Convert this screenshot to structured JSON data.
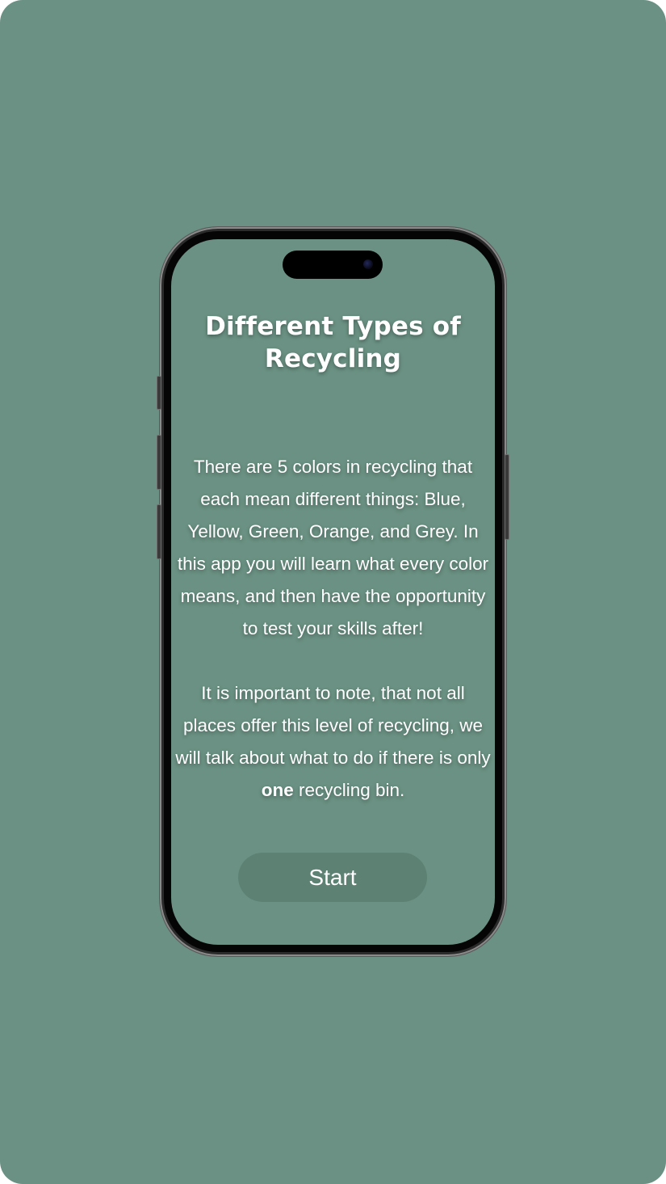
{
  "screen": {
    "title": "Different Types of Recycling",
    "paragraph1": "There are 5 colors in recycling that each mean different things: Blue, Yellow, Green, Orange, and Grey. In this app you will learn what every color means, and then have the opportunity to test your skills after!",
    "paragraph2_before": "It is important to note, that not all places offer this level of recycling, we will talk about what to do if there is only ",
    "paragraph2_bold": "one",
    "paragraph2_after": " recycling bin.",
    "start_label": "Start"
  },
  "colors": {
    "background": "#6a9183",
    "button": "#5d8274",
    "text": "#ffffff"
  }
}
